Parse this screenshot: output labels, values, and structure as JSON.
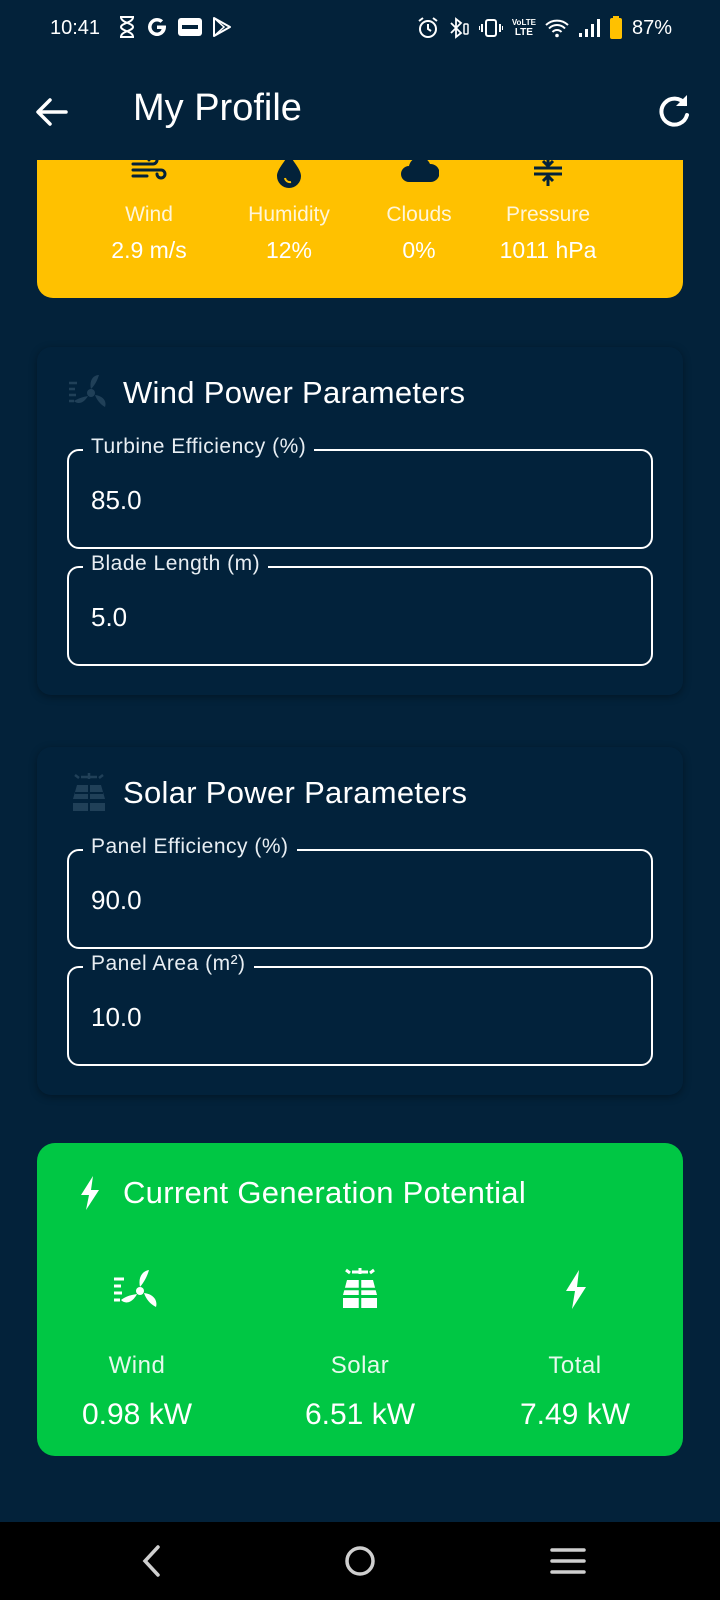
{
  "status_bar": {
    "time": "10:41",
    "battery_percent": "87%",
    "volte_top": "VoLTE",
    "volte_bottom": "LTE",
    "icons": [
      "hourglass-icon",
      "google-icon",
      "paytm-icon",
      "play-store-icon",
      "alarm-icon",
      "bluetooth-icon",
      "vibrate-icon",
      "volte-icon",
      "wifi-icon",
      "signal-icon",
      "battery-icon"
    ]
  },
  "app_bar": {
    "title": "My Profile",
    "back_icon": "arrow-back-icon",
    "refresh_icon": "refresh-icon"
  },
  "weather": {
    "items": [
      {
        "label": "Wind",
        "value": "2.9 m/s",
        "icon": "wind-icon"
      },
      {
        "label": "Humidity",
        "value": "12%",
        "icon": "humidity-drop-icon"
      },
      {
        "label": "Clouds",
        "value": "0%",
        "icon": "cloud-icon"
      },
      {
        "label": "Pressure",
        "value": "1011 hPa",
        "icon": "pressure-icon"
      }
    ],
    "bg_color": "#ffc100"
  },
  "wind_params": {
    "title": "Wind Power Parameters",
    "fields": [
      {
        "label": "Turbine Efficiency (%)",
        "value": "85.0"
      },
      {
        "label": "Blade Length (m)",
        "value": "5.0"
      }
    ]
  },
  "solar_params": {
    "title": "Solar Power Parameters",
    "fields": [
      {
        "label": "Panel Efficiency (%)",
        "value": "90.0"
      },
      {
        "label": "Panel Area (m²)",
        "value": "10.0"
      }
    ]
  },
  "generation": {
    "title": "Current Generation Potential",
    "bg_color": "#00c744",
    "items": [
      {
        "label": "Wind",
        "value": "0.98 kW",
        "icon": "wind-turbine-icon"
      },
      {
        "label": "Solar",
        "value": "6.51 kW",
        "icon": "solar-panel-icon"
      },
      {
        "label": "Total",
        "value": "7.49 kW",
        "icon": "bolt-icon"
      }
    ]
  },
  "nav_bar": {
    "buttons": [
      "nav-back-icon",
      "nav-home-icon",
      "nav-recents-icon"
    ]
  }
}
